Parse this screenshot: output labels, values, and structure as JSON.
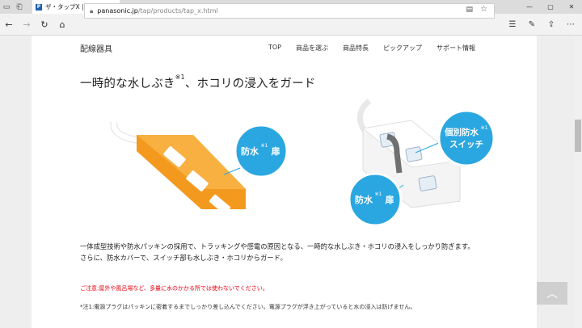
{
  "browser": {
    "tab_title": "ザ・タップX | 配線器具",
    "tab_favicon": "P",
    "url_host": "panasonic.jp",
    "url_path": "/tap/products/tap_x.html"
  },
  "site": {
    "logo": "配線器具",
    "menu": [
      "TOP",
      "商品を選ぶ",
      "商品特長",
      "ピックアップ",
      "サポート情報"
    ]
  },
  "section": {
    "heading_pre": "一時的な水しぶき",
    "heading_sup": "※1",
    "heading_post": "、ホコリの浸入をガード",
    "callouts": {
      "left_main": "防水",
      "left_sup": "※1",
      "left_tail": "扉",
      "right_top_line1": "個別防水",
      "right_top_sup": "※1",
      "right_top_line2": "スイッチ",
      "right_bottom_main": "防水",
      "right_bottom_sup": "※1",
      "right_bottom_tail": "扉"
    },
    "paragraph_1": "一体成型技術や防水パッキンの採用で、トラッキングや感電の原因となる、一時的な水しぶき・ホコリの浸入をしっかり防ぎます。",
    "paragraph_2": "さらに、防水カバーで、スイッチ部も水しぶき・ホコリからガード。",
    "caution": "ご注意:屋外や風呂場など、多量に水のかかる所では使わないでください。",
    "note": "*注1:電源プラグはパッキンに密着するまでしっかり差し込んでください。電源プラグが浮き上がっていると水の浸入は防げません。"
  },
  "colors": {
    "accent_blue": "#2aa7e0",
    "orange": "#f39a1e",
    "caution_red": "#e60012"
  }
}
